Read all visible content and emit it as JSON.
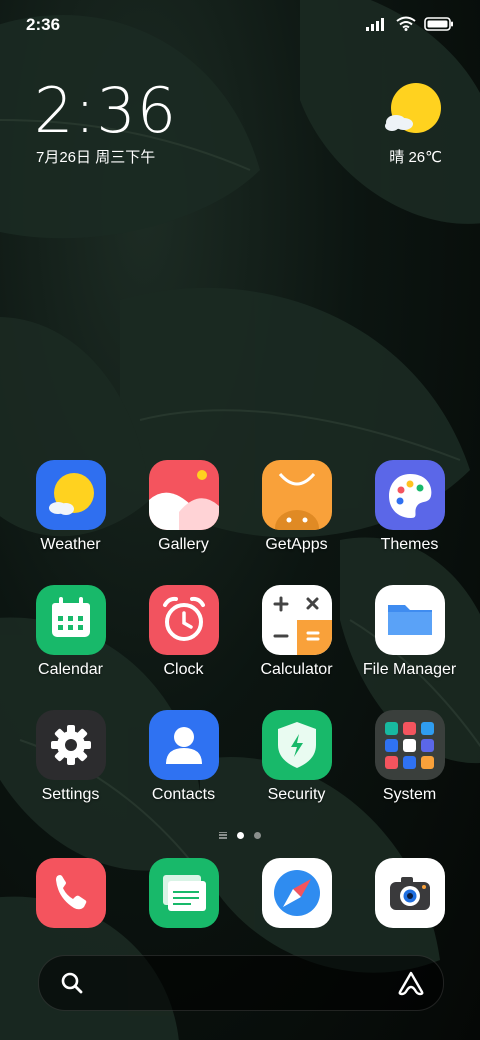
{
  "status_bar": {
    "time": "2:36",
    "icons": [
      "signal-icon",
      "wifi-icon",
      "battery-icon"
    ]
  },
  "clock_widget": {
    "time": "2:36",
    "date": "7月26日 周三下午"
  },
  "weather_widget": {
    "icon": "sun-cloud-icon",
    "text": "晴 26℃"
  },
  "apps": [
    {
      "label": "Weather",
      "icon": "weather-icon",
      "bg": "#2f6ff0"
    },
    {
      "label": "Gallery",
      "icon": "gallery-icon",
      "bg": "#f4545e"
    },
    {
      "label": "GetApps",
      "icon": "getapps-icon",
      "bg": "#f9a13a"
    },
    {
      "label": "Themes",
      "icon": "themes-icon",
      "bg": "#5b67e8"
    },
    {
      "label": "Calendar",
      "icon": "calendar-icon",
      "bg": "#18b96a"
    },
    {
      "label": "Clock",
      "icon": "alarm-clock-icon",
      "bg": "#f2535f"
    },
    {
      "label": "Calculator",
      "icon": "calculator-icon",
      "bg": "#ffffff"
    },
    {
      "label": "File Manager",
      "icon": "folder-icon",
      "bg": "#ffffff"
    },
    {
      "label": "Settings",
      "icon": "gear-icon",
      "bg": "#2c2c2e"
    },
    {
      "label": "Contacts",
      "icon": "contacts-icon",
      "bg": "#2f72f2"
    },
    {
      "label": "Security",
      "icon": "shield-icon",
      "bg": "#18b96a"
    },
    {
      "label": "System",
      "icon": "folder-grid-icon",
      "bg": "#3a3f3c"
    }
  ],
  "page_indicator": {
    "pages": 2,
    "active": 0
  },
  "dock": [
    {
      "name": "phone",
      "icon": "phone-icon",
      "bg": "#f4545e"
    },
    {
      "name": "messages",
      "icon": "messages-icon",
      "bg": "#18b96a"
    },
    {
      "name": "browser",
      "icon": "compass-icon",
      "bg": "#ffffff"
    },
    {
      "name": "camera",
      "icon": "camera-icon",
      "bg": "#ffffff"
    }
  ],
  "search_bar": {
    "left_icon": "search-icon",
    "right_icon": "assistant-icon"
  }
}
